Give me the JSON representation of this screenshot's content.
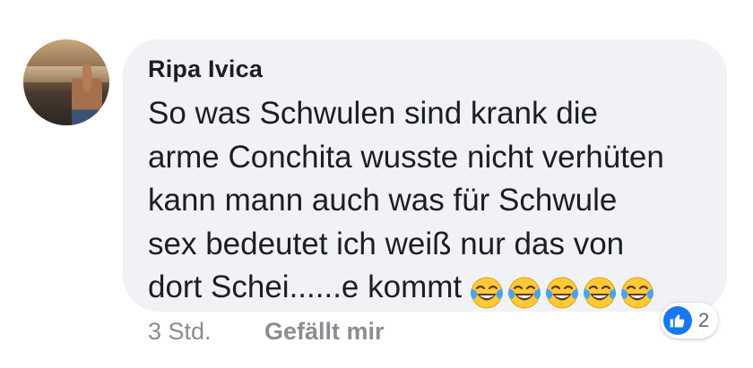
{
  "comment": {
    "author": "Ripa Ivica",
    "lines": [
      "So was Schwulen sind krank die",
      "arme Conchita wusste nicht verhüten",
      "kann mann auch was für Schwule",
      "sex bedeutet ich weiß nur das von",
      "dort Schei......e kommt"
    ],
    "emoji": [
      "face-with-tears-of-joy",
      "face-with-tears-of-joy",
      "face-with-tears-of-joy",
      "face-with-tears-of-joy",
      "face-with-tears-of-joy"
    ]
  },
  "meta": {
    "time": "3 Std.",
    "like_label": "Gefällt mir"
  },
  "reactions": {
    "icon": "like-thumb-icon",
    "count": "2",
    "color": "#1877f2"
  },
  "colors": {
    "bubble": "#f0f2f5",
    "text": "#1c1e21",
    "meta": "#8a8d91"
  }
}
